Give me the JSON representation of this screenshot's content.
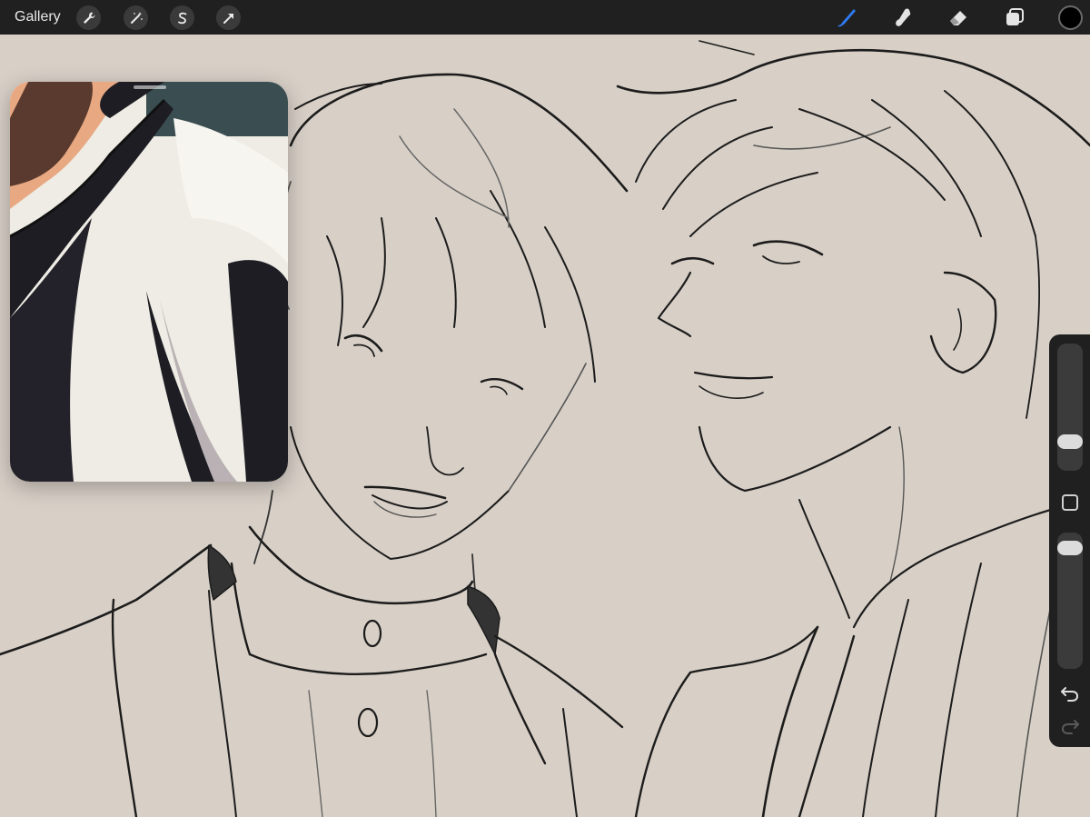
{
  "toolbar": {
    "gallery_label": "Gallery",
    "left_tools": [
      {
        "name": "actions",
        "icon": "wrench-icon"
      },
      {
        "name": "adjustments",
        "icon": "magic-wand-icon"
      },
      {
        "name": "selection",
        "icon": "selection-s-icon"
      },
      {
        "name": "transform",
        "icon": "arrow-cursor-icon"
      }
    ],
    "right_tools": [
      {
        "name": "brush",
        "icon": "brush-icon",
        "active": true
      },
      {
        "name": "smudge",
        "icon": "smudge-icon",
        "active": false
      },
      {
        "name": "eraser",
        "icon": "eraser-icon",
        "active": false
      },
      {
        "name": "layers",
        "icon": "layers-icon",
        "active": false
      }
    ],
    "current_color": "#000000",
    "accent_color": "#2f7cf6"
  },
  "sidebar": {
    "brush_size_level": 0.18,
    "opacity_level": 0.95,
    "icons": [
      "modify-square-icon",
      "undo-icon",
      "redo-icon"
    ]
  },
  "reference_window": {
    "content": "reference-image"
  }
}
